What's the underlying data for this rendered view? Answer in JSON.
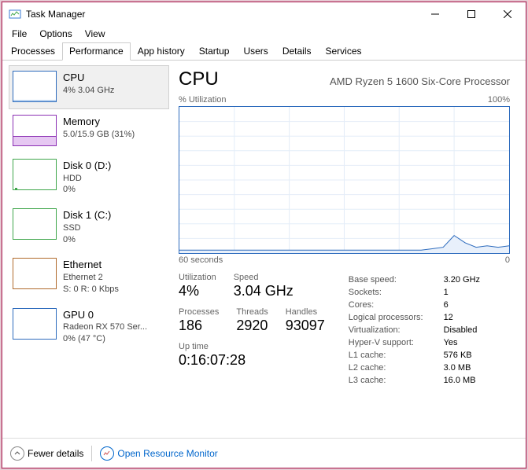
{
  "window": {
    "title": "Task Manager"
  },
  "menu": {
    "file": "File",
    "options": "Options",
    "view": "View"
  },
  "tabs": {
    "processes": "Processes",
    "performance": "Performance",
    "app_history": "App history",
    "startup": "Startup",
    "users": "Users",
    "details": "Details",
    "services": "Services"
  },
  "sidebar": {
    "cpu": {
      "name": "CPU",
      "sub1": "4%  3.04 GHz",
      "color": "#2d6bbd"
    },
    "memory": {
      "name": "Memory",
      "sub1": "5.0/15.9 GB (31%)",
      "color": "#8b2fb3"
    },
    "disk0": {
      "name": "Disk 0 (D:)",
      "sub1": "HDD",
      "sub2": "0%",
      "color": "#3fa64b"
    },
    "disk1": {
      "name": "Disk 1 (C:)",
      "sub1": "SSD",
      "sub2": "0%",
      "color": "#3fa64b"
    },
    "eth": {
      "name": "Ethernet",
      "sub1": "Ethernet 2",
      "sub2": "S: 0  R: 0 Kbps",
      "color": "#b06a2c"
    },
    "gpu": {
      "name": "GPU 0",
      "sub1": "Radeon RX 570 Ser...",
      "sub2": "0%  (47 °C)",
      "color": "#2d6bbd"
    }
  },
  "main": {
    "title": "CPU",
    "model": "AMD Ryzen 5 1600 Six-Core Processor",
    "chart_top_left": "% Utilization",
    "chart_top_right": "100%",
    "chart_bot_left": "60 seconds",
    "chart_bot_right": "0",
    "stats": {
      "utilization_lbl": "Utilization",
      "utilization": "4%",
      "speed_lbl": "Speed",
      "speed": "3.04 GHz",
      "processes_lbl": "Processes",
      "processes": "186",
      "threads_lbl": "Threads",
      "threads": "2920",
      "handles_lbl": "Handles",
      "handles": "93097",
      "uptime_lbl": "Up time",
      "uptime": "0:16:07:28"
    },
    "right": {
      "base_lbl": "Base speed:",
      "base": "3.20 GHz",
      "sockets_lbl": "Sockets:",
      "sockets": "1",
      "cores_lbl": "Cores:",
      "cores": "6",
      "lp_lbl": "Logical processors:",
      "lp": "12",
      "virt_lbl": "Virtualization:",
      "virt": "Disabled",
      "hv_lbl": "Hyper-V support:",
      "hv": "Yes",
      "l1_lbl": "L1 cache:",
      "l1": "576 KB",
      "l2_lbl": "L2 cache:",
      "l2": "3.0 MB",
      "l3_lbl": "L3 cache:",
      "l3": "16.0 MB"
    }
  },
  "footer": {
    "fewer": "Fewer details",
    "orm": "Open Resource Monitor"
  },
  "chart_data": {
    "type": "line",
    "title": "% Utilization",
    "xlabel": "60 seconds",
    "ylabel": "",
    "ylim": [
      0,
      100
    ],
    "x_seconds_ago": [
      60,
      58,
      56,
      54,
      52,
      50,
      48,
      46,
      44,
      42,
      40,
      38,
      36,
      34,
      32,
      30,
      28,
      26,
      24,
      22,
      20,
      18,
      16,
      14,
      12,
      10,
      8,
      6,
      4,
      2,
      0
    ],
    "values": [
      2,
      2,
      2,
      2,
      2,
      2,
      2,
      2,
      2,
      2,
      2,
      2,
      2,
      2,
      2,
      2,
      2,
      2,
      2,
      2,
      2,
      2,
      2,
      3,
      4,
      12,
      7,
      4,
      5,
      4,
      5
    ]
  }
}
